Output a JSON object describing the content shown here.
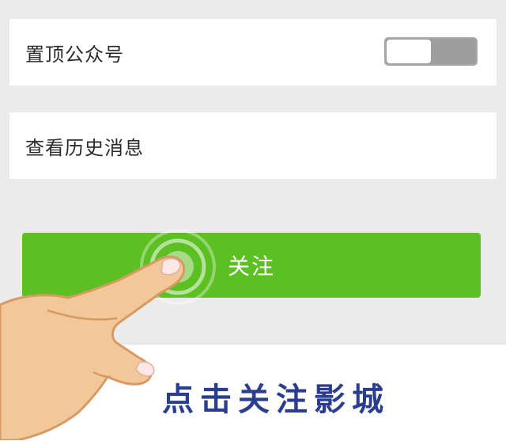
{
  "settings": {
    "pin_account": {
      "label": "置顶公众号",
      "toggle_on": false
    },
    "view_history": {
      "label": "查看历史消息"
    }
  },
  "follow_button": {
    "label": "关注"
  },
  "caption": "点击关注影城",
  "colors": {
    "button_green": "#5cbf22",
    "caption_blue": "#2a3d8f",
    "toggle_grey": "#9e9e9e"
  },
  "icons": [
    "tap-ripple-icon",
    "pointing-hand-icon"
  ]
}
